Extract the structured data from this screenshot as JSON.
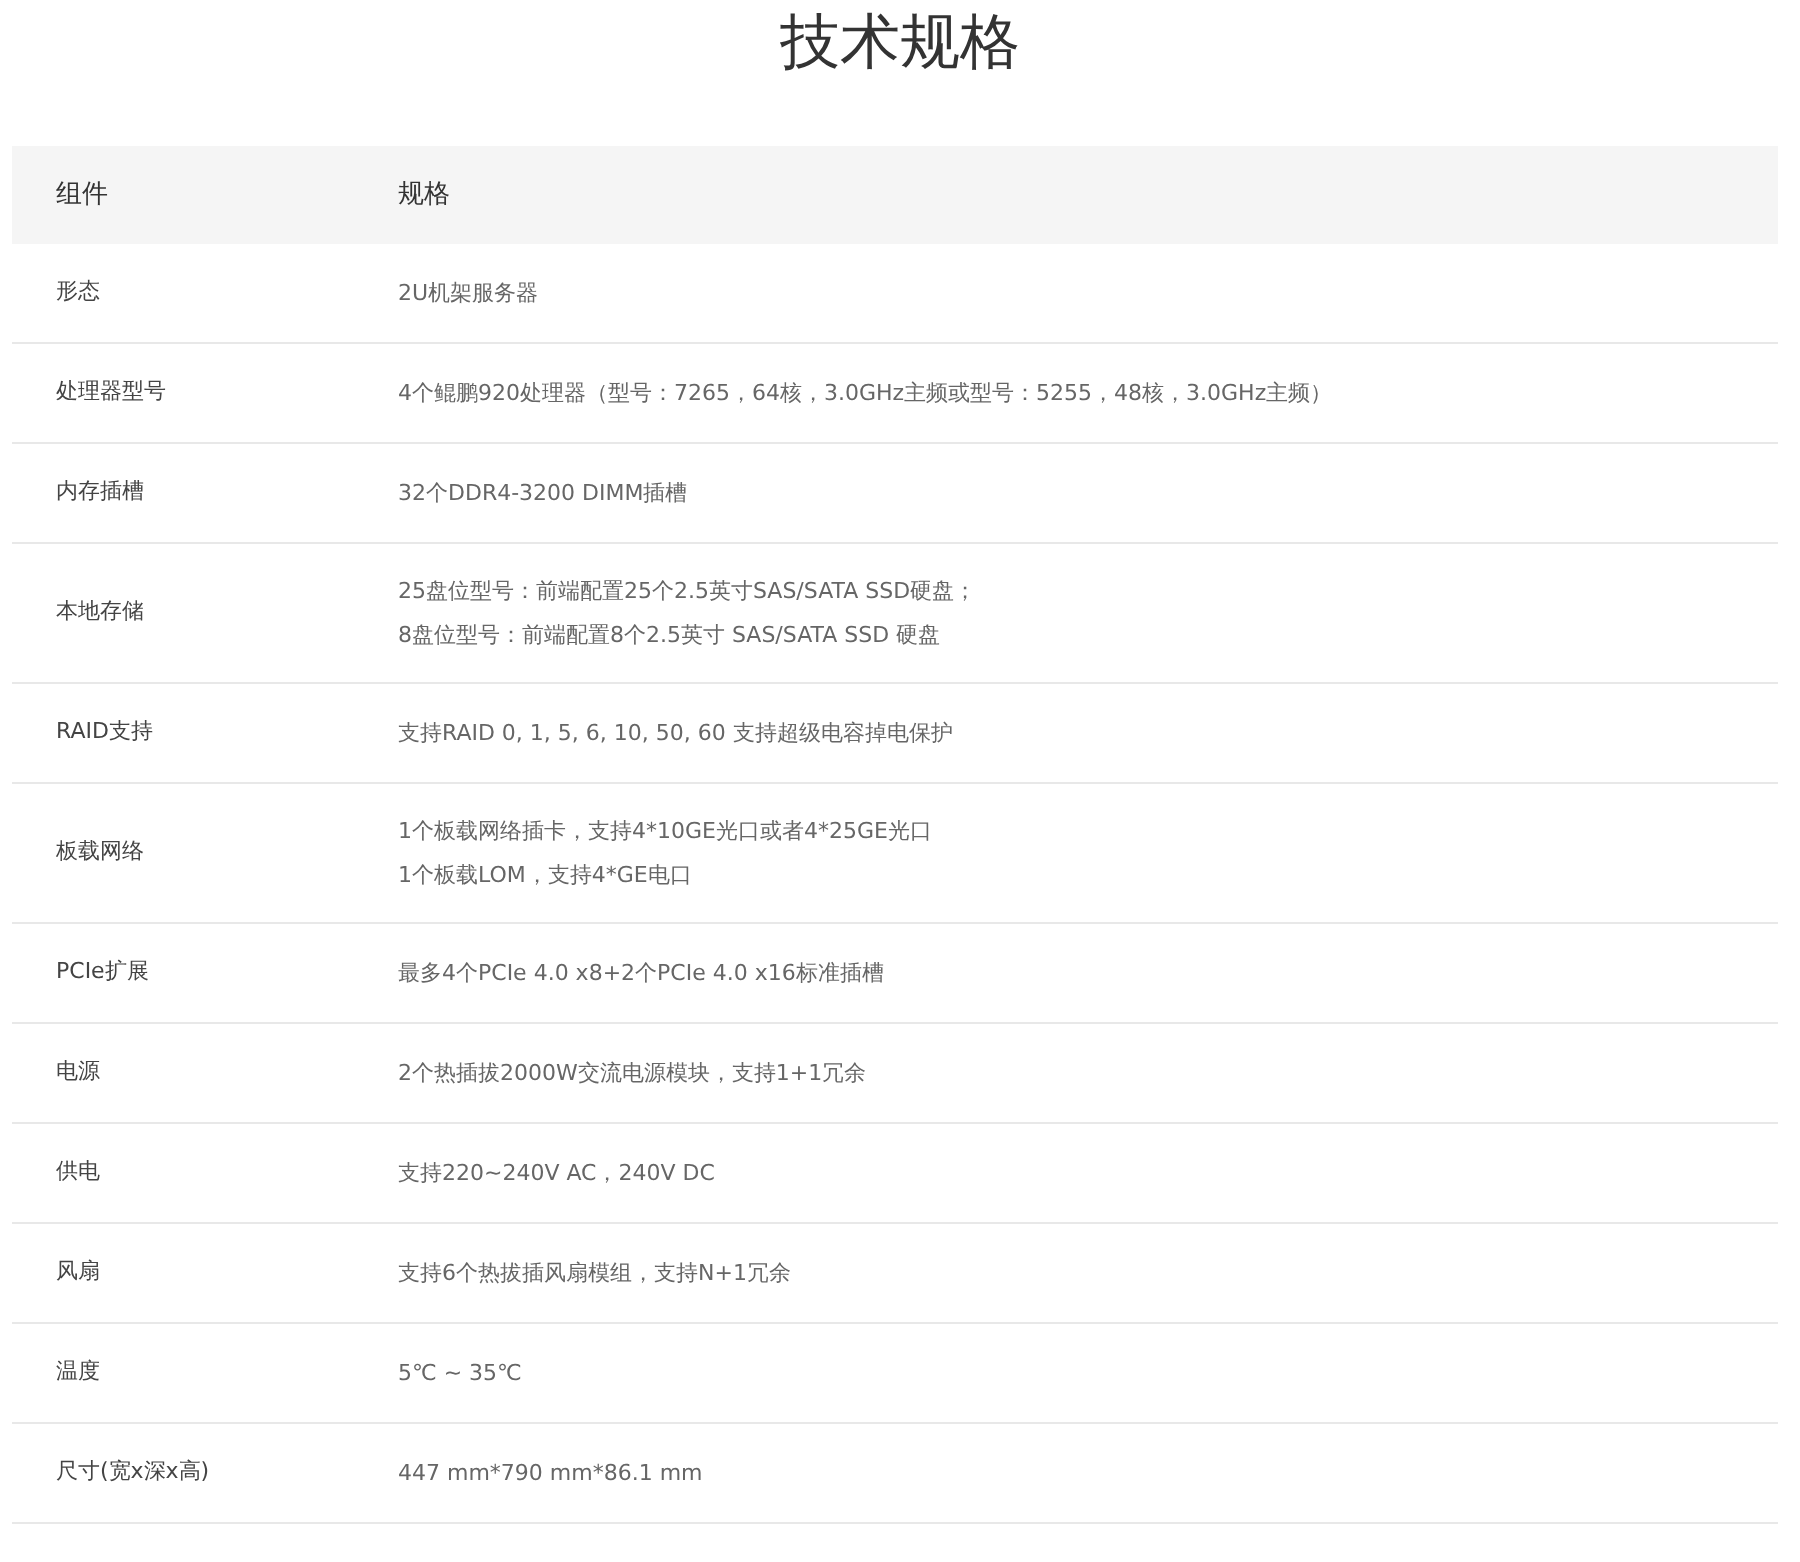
{
  "title": "技术规格",
  "table": {
    "columns": [
      "组件",
      "规格"
    ],
    "rows": [
      {
        "component": "形态",
        "spec": [
          "2U机架服务器"
        ]
      },
      {
        "component": "处理器型号",
        "spec": [
          "4个鲲鹏920处理器（型号：7265，64核，3.0GHz主频或型号：5255，48核，3.0GHz主频）"
        ]
      },
      {
        "component": "内存插槽",
        "spec": [
          "32个DDR4-3200 DIMM插槽"
        ]
      },
      {
        "component": "本地存储",
        "spec": [
          "25盘位型号：前端配置25个2.5英寸SAS/SATA SSD硬盘；",
          "8盘位型号：前端配置8个2.5英寸 SAS/SATA SSD 硬盘"
        ]
      },
      {
        "component": "RAID支持",
        "spec": [
          "支持RAID 0, 1, 5, 6, 10, 50, 60 支持超级电容掉电保护"
        ]
      },
      {
        "component": "板载网络",
        "spec": [
          "1个板载网络插卡，支持4*10GE光口或者4*25GE光口",
          "1个板载LOM，支持4*GE电口"
        ]
      },
      {
        "component": "PCIe扩展",
        "spec": [
          "最多4个PCIe 4.0 x8+2个PCIe 4.0 x16标准插槽"
        ]
      },
      {
        "component": "电源",
        "spec": [
          "2个热插拔2000W交流电源模块，支持1+1冗余"
        ]
      },
      {
        "component": "供电",
        "spec": [
          "支持220~240V AC，240V DC"
        ]
      },
      {
        "component": "风扇",
        "spec": [
          "支持6个热拔插风扇模组，支持N+1冗余"
        ]
      },
      {
        "component": "温度",
        "spec": [
          "5℃ ~ 35℃"
        ]
      },
      {
        "component": "尺寸(宽x深x高)",
        "spec": [
          "447 mm*790 mm*86.1 mm"
        ]
      }
    ]
  }
}
